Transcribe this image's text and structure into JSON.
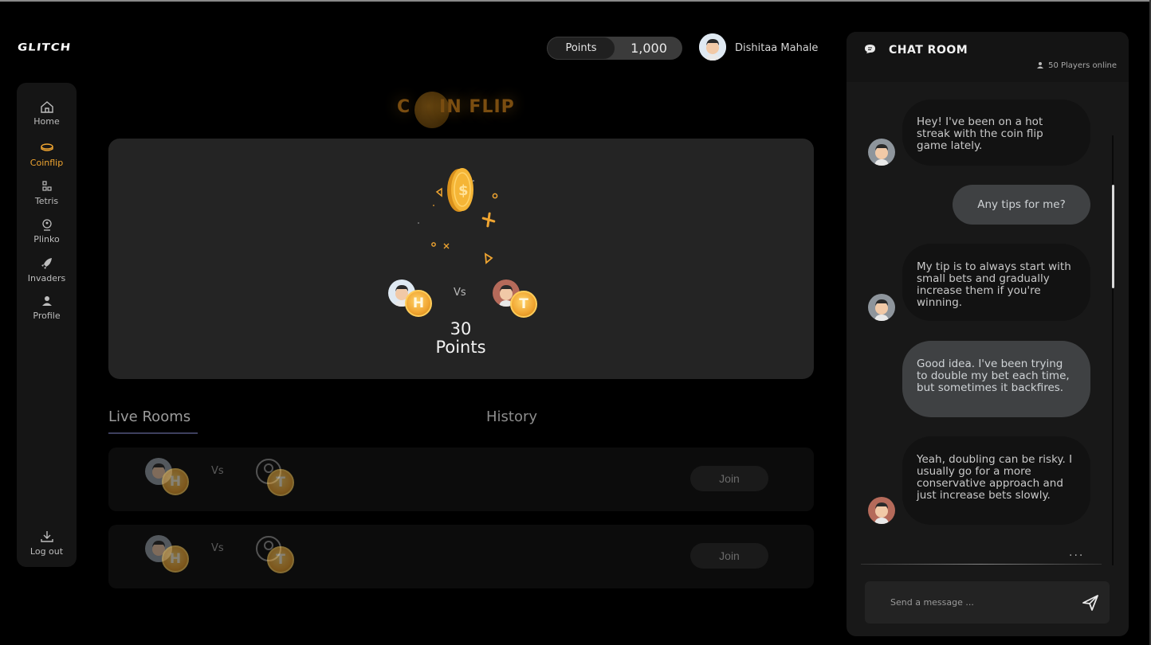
{
  "brand": {
    "logo_text": "GLITCH"
  },
  "sidebar": {
    "items": [
      {
        "label": "Home",
        "icon": "home-icon",
        "active": false
      },
      {
        "label": "Coinflip",
        "icon": "coin-icon",
        "active": true
      },
      {
        "label": "Tetris",
        "icon": "tetris-icon",
        "active": false
      },
      {
        "label": "Plinko",
        "icon": "plinko-icon",
        "active": false
      },
      {
        "label": "Invaders",
        "icon": "rocket-icon",
        "active": false
      },
      {
        "label": "Profile",
        "icon": "user-icon",
        "active": false
      }
    ],
    "logout_label": "Log out"
  },
  "header": {
    "points_label": "Points",
    "points_value": "1,000",
    "user_name": "Dishitaa Mahale"
  },
  "game": {
    "title_prefix": "C",
    "title_suffix": "IN FLIP",
    "vs_label": "Vs",
    "left_side": "H",
    "right_side": "T",
    "bet_amount": "30",
    "bet_unit": "Points"
  },
  "tabs": {
    "live": "Live Rooms",
    "history": "History"
  },
  "rooms": [
    {
      "vs_label": "Vs",
      "left_side": "H",
      "right_side": "T",
      "join_label": "Join"
    },
    {
      "vs_label": "Vs",
      "left_side": "H",
      "right_side": "T",
      "join_label": "Join"
    }
  ],
  "chat": {
    "title": "CHAT ROOM",
    "online": "50 Players online",
    "messages": [
      {
        "from": "other",
        "text": "Hey! I've been on a hot streak with the coin flip game lately."
      },
      {
        "from": "me",
        "text": "Any tips for me?"
      },
      {
        "from": "other",
        "text": "My tip is to always start with small bets and gradually increase them if you're winning."
      },
      {
        "from": "me",
        "text": "Good idea. I've been trying to double my bet each time, but sometimes it backfires."
      },
      {
        "from": "other",
        "text": "Yeah, doubling can be risky. I usually go for a more conservative approach and just increase bets slowly."
      }
    ],
    "typing_indicator": "...",
    "input_placeholder": "Send a message ..."
  },
  "colors": {
    "accent": "#f0a531",
    "background": "#000000",
    "panel": "#242424"
  }
}
